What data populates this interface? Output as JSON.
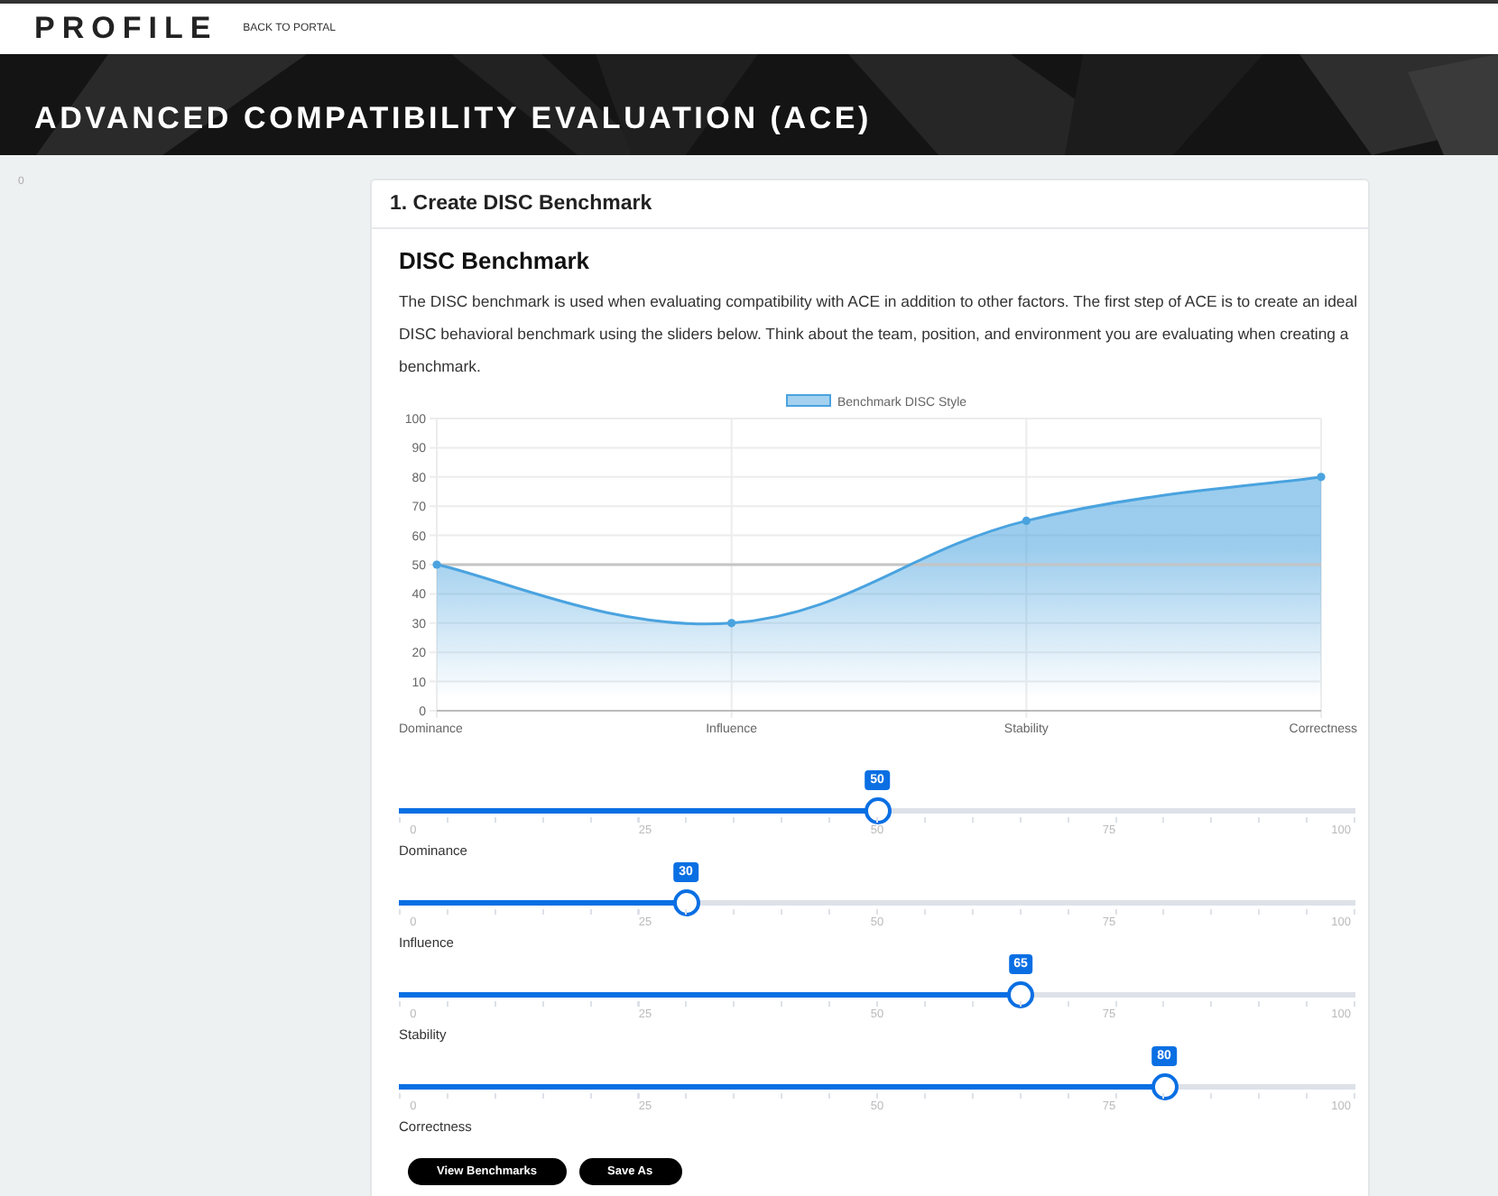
{
  "top_bar": {
    "logo": "PROFILE",
    "link": "BACK TO PORTAL"
  },
  "banner": {
    "title": "ADVANCED COMPATIBILITY EVALUATION (ACE)",
    "kind": "picture"
  },
  "side_note": "0",
  "card": {
    "header": "1. Create DISC Benchmark",
    "heading": "DISC Benchmark",
    "description": "The DISC benchmark is used when evaluating compatibility with ACE in addition to other factors. The first step of ACE is to create an ideal DISC behavioral benchmark using the sliders below. Think about the team, position, and environment you are evaluating when creating a benchmark.",
    "chart_data": {
      "type": "area",
      "categories": [
        "Dominance",
        "Influence",
        "Stability",
        "Correctness"
      ],
      "series": [
        {
          "name": "Benchmark DISC Style",
          "color": "#4aa3df",
          "values": [
            50,
            30,
            65,
            80
          ]
        },
        {
          "type": "line",
          "color": "#c4c4c4",
          "values": [
            50,
            50,
            50,
            50
          ]
        }
      ],
      "ylim": [
        0,
        100
      ],
      "yticks": [
        0,
        10,
        20,
        30,
        40,
        50,
        60,
        70,
        80,
        90,
        100
      ],
      "grid": true
    },
    "sliders": [
      {
        "name": "Dominance",
        "value": "50",
        "level": 0.5,
        "scale": [
          "0",
          "25",
          "50",
          "75",
          "100"
        ]
      },
      {
        "name": "Influence",
        "value": "30",
        "level": 0.3,
        "scale": [
          "0",
          "25",
          "50",
          "75",
          "100"
        ]
      },
      {
        "name": "Stability",
        "value": "65",
        "level": 0.65,
        "scale": [
          "0",
          "25",
          "50",
          "75",
          "100"
        ]
      },
      {
        "name": "Correctness",
        "value": "80",
        "level": 0.8,
        "scale": [
          "0",
          "25",
          "50",
          "75",
          "100"
        ]
      }
    ],
    "buttons": [
      "View Benchmarks",
      "Save As"
    ]
  }
}
